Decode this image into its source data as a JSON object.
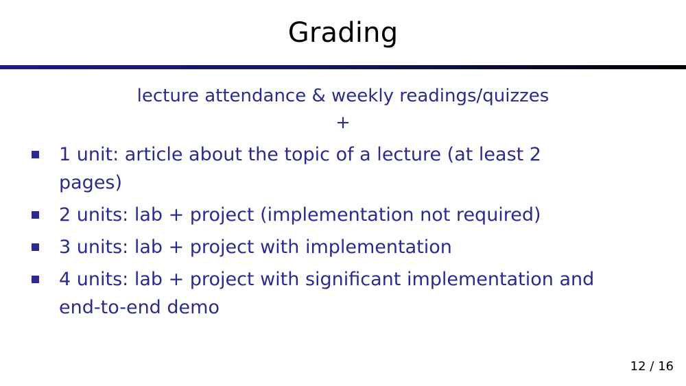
{
  "slide": {
    "title": "Grading",
    "subtitle_line1": "lecture attendance & weekly readings/quizzes",
    "subtitle_line2": "+",
    "bullets": [
      "1 unit: article about the topic of a lecture (at least 2 pages)",
      "2 units: lab + project (implementation not required)",
      "3 units: lab + project with implementation",
      "4 units: lab + project with significant implementation and end-to-end demo"
    ],
    "page_number": "12 / 16"
  },
  "colors": {
    "text_blue": "#2b2b8f",
    "title_black": "#000000",
    "rule_blue": "#1a1a8c"
  }
}
